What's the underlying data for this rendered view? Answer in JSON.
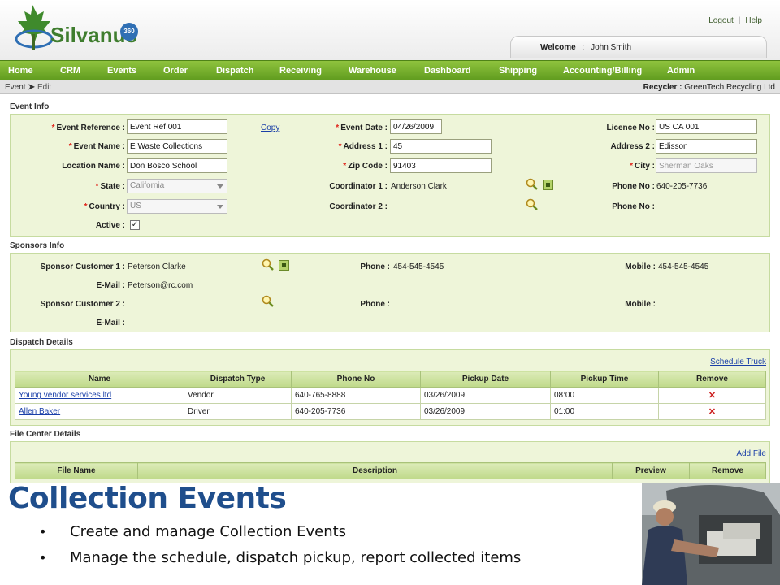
{
  "header": {
    "logo_text": "Silvanus",
    "logo_badge": "360",
    "logout": "Logout",
    "separator": "|",
    "help": "Help",
    "welcome_label": "Welcome",
    "welcome_colon": ":",
    "user_name": "John Smith"
  },
  "nav": [
    "Home",
    "CRM",
    "Events",
    "Order",
    "Dispatch",
    "Receiving",
    "Warehouse",
    "Dashboard",
    "Shipping",
    "Accounting/Billing",
    "Admin"
  ],
  "breadcrumb": {
    "parent": "Event",
    "arrow": "➤",
    "current": "Edit"
  },
  "recycler": {
    "label": "Recycler :",
    "value": "GreenTech Recycling Ltd"
  },
  "event_info": {
    "title": "Event Info",
    "required_mark": "*",
    "event_reference_label": "Event Reference :",
    "event_reference": "Event Ref 001",
    "copy_link": "Copy",
    "event_date_label": "Event Date :",
    "event_date": "04/26/2009",
    "licence_no_label": "Licence No :",
    "licence_no": "US CA 001",
    "event_name_label": "Event Name :",
    "event_name": "E Waste Collections",
    "address1_label": "Address 1 :",
    "address1": "45",
    "address2_label": "Address 2 :",
    "address2": "Edisson",
    "location_name_label": "Location Name :",
    "location_name": "Don Bosco School",
    "zip_label": "Zip Code :",
    "zip": "91403",
    "city_label": "City :",
    "city": "Sherman Oaks",
    "state_label": "State :",
    "state": "California",
    "coordinator1_label": "Coordinator 1 :",
    "coordinator1": "Anderson Clark",
    "phone_label": "Phone No :",
    "phone": "640-205-7736",
    "country_label": "Country :",
    "country": "US",
    "coordinator2_label": "Coordinator 2 :",
    "phone2_label": "Phone No :",
    "active_label": "Active :",
    "active_check": "✓"
  },
  "sponsors": {
    "title": "Sponsors Info",
    "sponsor1_label": "Sponsor Customer 1 :",
    "sponsor1": "Peterson Clarke",
    "phone1_label": "Phone :",
    "phone1": "454-545-4545",
    "mobile1_label": "Mobile :",
    "mobile1": "454-545-4545",
    "email1_label": "E-Mail :",
    "email1": "Peterson@rc.com",
    "sponsor2_label": "Sponsor Customer 2 :",
    "phone2_label": "Phone :",
    "mobile2_label": "Mobile :",
    "email2_label": "E-Mail :"
  },
  "dispatch": {
    "title": "Dispatch Details",
    "schedule_link": "Schedule Truck",
    "columns": [
      "Name",
      "Dispatch Type",
      "Phone No",
      "Pickup Date",
      "Pickup Time",
      "Remove"
    ],
    "rows": [
      {
        "name": "Young vendor services ltd",
        "type": "Vendor",
        "phone": "640-765-8888",
        "date": "03/26/2009",
        "time": "08:00",
        "remove": "✕"
      },
      {
        "name": "Allen Baker",
        "type": "Driver",
        "phone": "640-205-7736",
        "date": "03/26/2009",
        "time": "01:00",
        "remove": "✕"
      }
    ]
  },
  "file_center": {
    "title": "File Center Details",
    "add_link": "Add File",
    "columns": [
      "File Name",
      "Description",
      "Preview",
      "Remove"
    ]
  },
  "slide": {
    "title": "Collection Events",
    "bullets": [
      "Create and manage Collection Events",
      "Manage the schedule, dispatch pickup, report collected items"
    ]
  }
}
